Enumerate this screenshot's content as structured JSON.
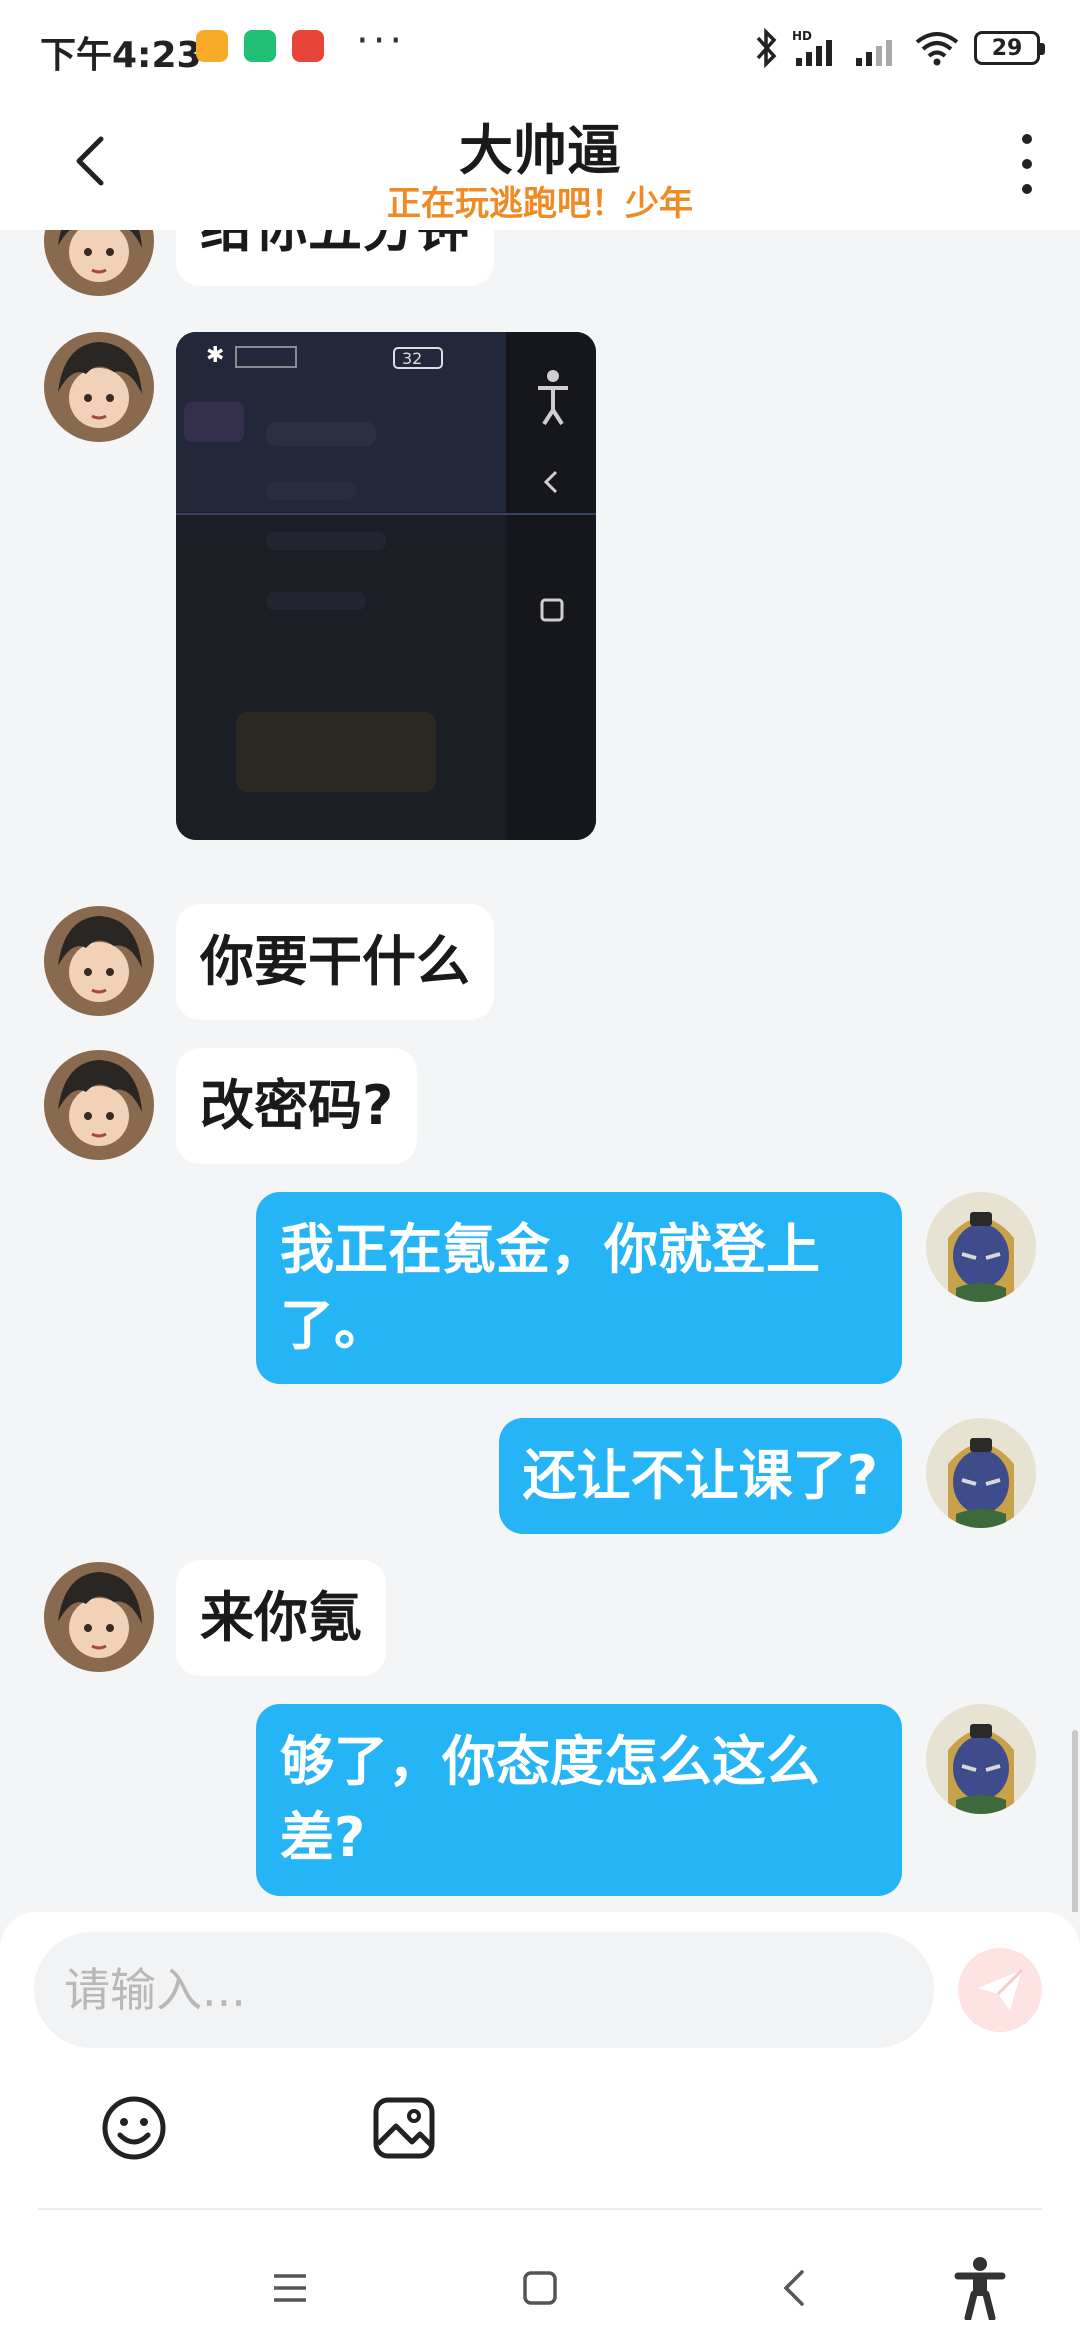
{
  "status_bar": {
    "time": "下午4:23",
    "more_label": "···",
    "battery": "29",
    "icons": [
      "notes-app-icon",
      "security-app-icon",
      "mascot-app-icon",
      "bluetooth-icon",
      "hd-signal-icon",
      "signal-icon",
      "wifi-icon",
      "battery-icon"
    ]
  },
  "header": {
    "title": "大帅逼",
    "subtitle": "正在玩逃跑吧！少年",
    "back_icon": "chevron-left-icon",
    "more_icon": "more-vertical-icon"
  },
  "messages": [
    {
      "side": "in",
      "type": "text",
      "text": "给你五分钟"
    },
    {
      "side": "in",
      "type": "image",
      "text": "",
      "battery_text": "32"
    },
    {
      "side": "in",
      "type": "text",
      "text": "你要干什么"
    },
    {
      "side": "in",
      "type": "text",
      "text": "改密码?"
    },
    {
      "side": "out",
      "type": "text",
      "text": "我正在氪金，你就登上了。"
    },
    {
      "side": "out",
      "type": "text",
      "text": "还让不让课了?"
    },
    {
      "side": "in",
      "type": "text",
      "text": "来你氪"
    },
    {
      "side": "out",
      "type": "text",
      "text": "够了，你态度怎么这么差?"
    }
  ],
  "input": {
    "placeholder": "请输入...",
    "value": ""
  },
  "toolbar": {
    "emoji_icon": "emoji-icon",
    "image_icon": "image-icon",
    "send_icon": "send-icon"
  },
  "nav_bar": {
    "icons": [
      "menu-icon",
      "home-icon",
      "back-icon",
      "accessibility-icon"
    ]
  },
  "colors": {
    "outgoing_bubble": "#25b4f5",
    "incoming_bubble": "#ffffff",
    "subtitle": "#f08a24",
    "background": "#f4f5f7"
  }
}
